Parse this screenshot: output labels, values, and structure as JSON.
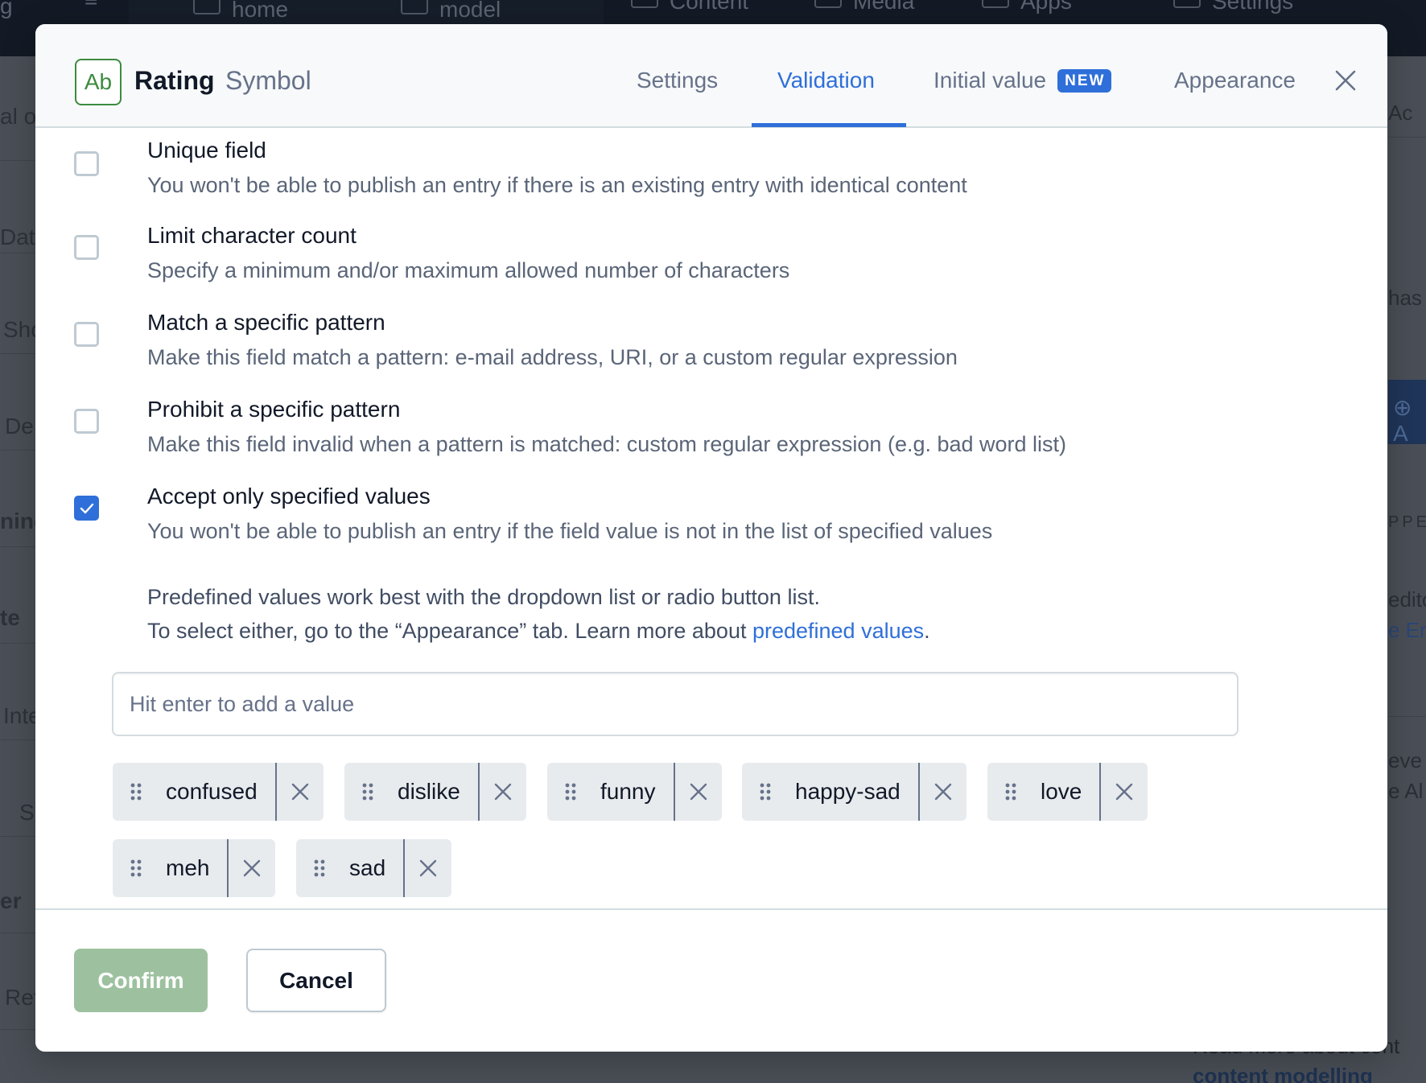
{
  "background": {
    "nav_items": [
      {
        "label": "home",
        "icon": "home-icon"
      },
      {
        "label": "model",
        "icon": "cube-icon"
      },
      {
        "label": "Content",
        "icon": "edit-icon"
      },
      {
        "label": "Media",
        "icon": "image-icon"
      },
      {
        "label": "Apps",
        "icon": "puzzle-icon"
      },
      {
        "label": "Settings",
        "icon": "gear-icon"
      }
    ],
    "left_fragments": [
      "al or",
      "Dat",
      "Sho",
      "De",
      "ning",
      "te",
      "Inte",
      "S",
      "er",
      "Ref"
    ],
    "right_fragments": [
      "Ac",
      "has u",
      "A",
      "PPEA",
      "edito",
      "e Ent",
      "eve",
      "e Al",
      "Read more about cont",
      "content modelling"
    ]
  },
  "modal": {
    "header": {
      "type_icon_text": "Ab",
      "field_name": "Rating",
      "field_type": "Symbol",
      "tabs": [
        {
          "label": "Settings",
          "active": false
        },
        {
          "label": "Validation",
          "active": true
        },
        {
          "label": "Initial value",
          "active": false,
          "badge": "NEW"
        },
        {
          "label": "Appearance",
          "active": false
        }
      ],
      "close_label": "close"
    },
    "validations": [
      {
        "title": "Unique field",
        "description": "You won't be able to publish an entry if there is an existing entry with identical content",
        "checked": false
      },
      {
        "title": "Limit character count",
        "description": "Specify a minimum and/or maximum allowed number of characters",
        "checked": false
      },
      {
        "title": "Match a specific pattern",
        "description": "Make this field match a pattern: e-mail address, URI, or a custom regular expression",
        "checked": false
      },
      {
        "title": "Prohibit a specific pattern",
        "description": "Make this field invalid when a pattern is matched: custom regular expression (e.g. bad word list)",
        "checked": false
      },
      {
        "title": "Accept only specified values",
        "description": "You won't be able to publish an entry if the field value is not in the list of specified values",
        "checked": true
      }
    ],
    "predefined": {
      "help_line1": "Predefined values work best with the dropdown list or radio button list.",
      "help_line2_prefix": "To select either, go to the “Appearance” tab. Learn more about ",
      "help_link": "predefined values",
      "help_line2_suffix": ".",
      "input_value": "",
      "input_placeholder": "Hit enter to add a value",
      "values": [
        "confused",
        "dislike",
        "funny",
        "happy-sad",
        "love",
        "meh",
        "sad"
      ]
    },
    "footer": {
      "confirm_label": "Confirm",
      "cancel_label": "Cancel"
    }
  },
  "colors": {
    "accent": "#2f6fd9",
    "confirm_disabled": "#9dc19f",
    "type_icon": "#3d8b3f"
  }
}
